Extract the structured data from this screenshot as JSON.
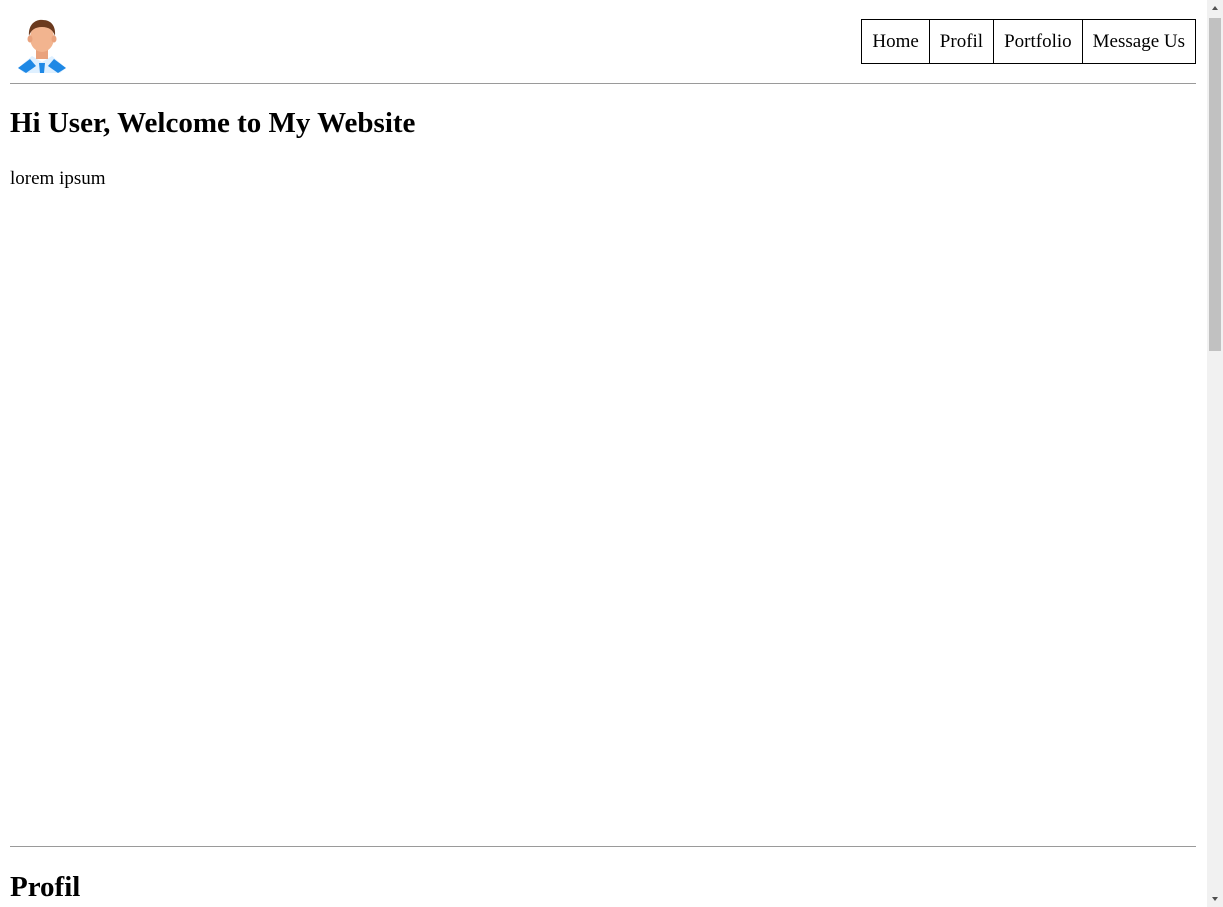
{
  "header": {
    "avatar_icon": "user-avatar-icon",
    "nav": {
      "items": [
        {
          "label": "Home"
        },
        {
          "label": "Profil"
        },
        {
          "label": "Portfolio"
        },
        {
          "label": "Message Us"
        }
      ]
    }
  },
  "hero": {
    "title": "Hi User, Welcome to My Website",
    "text": "lorem ipsum"
  },
  "profil_section": {
    "title": "Profil"
  },
  "colors": {
    "background": "#ffffff",
    "text": "#000000",
    "rule": "#9a9a9a",
    "scrollbar_track": "#f1f1f1",
    "scrollbar_thumb": "#c1c1c1",
    "avatar_hair": "#6b3a1e",
    "avatar_skin": "#f2b48f",
    "avatar_shirt": "#1e88e5"
  }
}
